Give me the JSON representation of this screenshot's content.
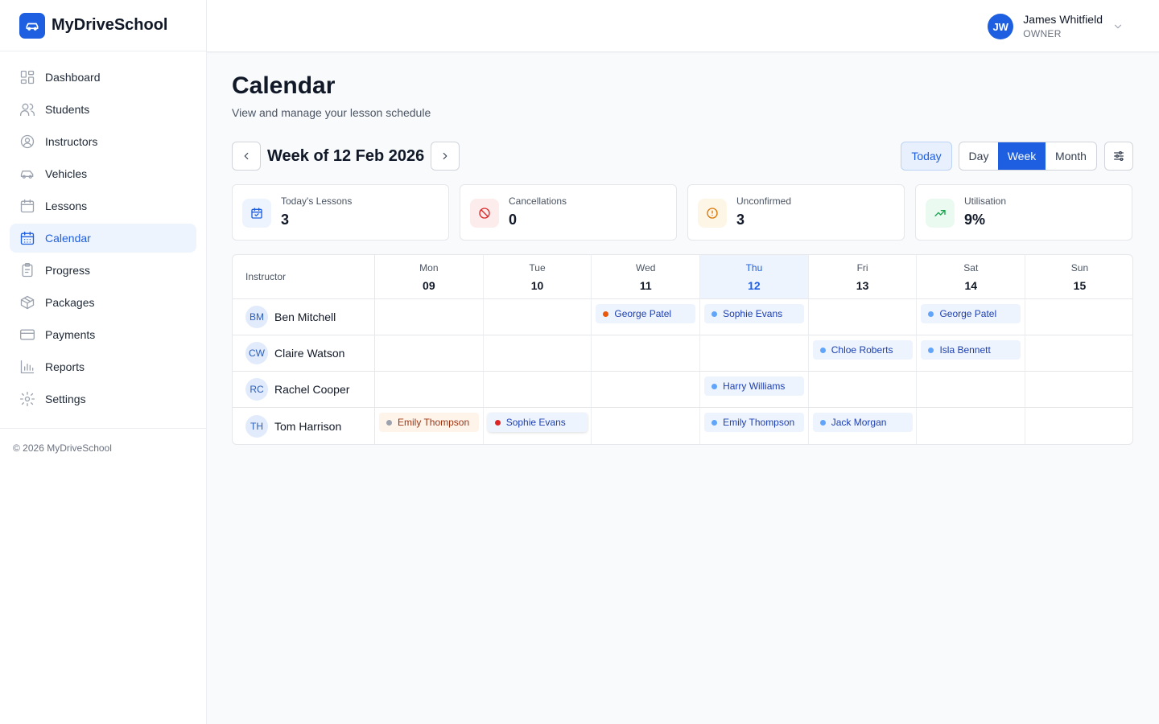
{
  "app": {
    "name": "MyDriveSchool",
    "copyright": "© 2026 MyDriveSchool"
  },
  "nav": [
    {
      "label": "Dashboard",
      "icon": "dashboard-icon",
      "active": false
    },
    {
      "label": "Students",
      "icon": "users-icon",
      "active": false
    },
    {
      "label": "Instructors",
      "icon": "user-circle-icon",
      "active": false
    },
    {
      "label": "Vehicles",
      "icon": "car-icon",
      "active": false
    },
    {
      "label": "Lessons",
      "icon": "calendar-icon",
      "active": false
    },
    {
      "label": "Calendar",
      "icon": "calendar-grid-icon",
      "active": true
    },
    {
      "label": "Progress",
      "icon": "clipboard-icon",
      "active": false
    },
    {
      "label": "Packages",
      "icon": "package-icon",
      "active": false
    },
    {
      "label": "Payments",
      "icon": "credit-card-icon",
      "active": false
    },
    {
      "label": "Reports",
      "icon": "bar-chart-icon",
      "active": false
    },
    {
      "label": "Settings",
      "icon": "gear-icon",
      "active": false
    }
  ],
  "user": {
    "initials": "JW",
    "name": "James Whitfield",
    "role": "OWNER"
  },
  "page": {
    "title": "Calendar",
    "subtitle": "View and manage your lesson schedule"
  },
  "toolbar": {
    "week_label": "Week of 12 Feb 2026",
    "today_label": "Today",
    "views": [
      "Day",
      "Week",
      "Month"
    ],
    "active_view": "Week"
  },
  "stats": [
    {
      "label": "Today's Lessons",
      "value": "3",
      "icon": "calendar-check-icon",
      "color": "#1d5fe0"
    },
    {
      "label": "Cancellations",
      "value": "0",
      "icon": "ban-icon",
      "color": "#dc2626"
    },
    {
      "label": "Unconfirmed",
      "value": "3",
      "icon": "alert-circle-icon",
      "color": "#d97706"
    },
    {
      "label": "Utilisation",
      "value": "9%",
      "icon": "trending-up-icon",
      "color": "#16a34a"
    }
  ],
  "calendar": {
    "instructor_header": "Instructor",
    "days": [
      {
        "name": "Mon",
        "num": "09"
      },
      {
        "name": "Tue",
        "num": "10"
      },
      {
        "name": "Wed",
        "num": "11"
      },
      {
        "name": "Thu",
        "num": "12",
        "today": true
      },
      {
        "name": "Fri",
        "num": "13"
      },
      {
        "name": "Sat",
        "num": "14"
      },
      {
        "name": "Sun",
        "num": "15"
      }
    ],
    "instructors": [
      {
        "initials": "BM",
        "name": "Ben Mitchell"
      },
      {
        "initials": "CW",
        "name": "Claire Watson"
      },
      {
        "initials": "RC",
        "name": "Rachel Cooper"
      },
      {
        "initials": "TH",
        "name": "Tom Harrison"
      }
    ],
    "lessons": [
      {
        "instructor": 0,
        "day": 2,
        "student": "George Patel",
        "status": "orange"
      },
      {
        "instructor": 0,
        "day": 3,
        "student": "Sophie Evans",
        "status": "blue"
      },
      {
        "instructor": 0,
        "day": 5,
        "student": "George Patel",
        "status": "blue"
      },
      {
        "instructor": 1,
        "day": 4,
        "student": "Chloe Roberts",
        "status": "blue"
      },
      {
        "instructor": 1,
        "day": 5,
        "student": "Isla Bennett",
        "status": "blue"
      },
      {
        "instructor": 2,
        "day": 3,
        "student": "Harry Williams",
        "status": "blue"
      },
      {
        "instructor": 3,
        "day": 0,
        "student": "Emily Thompson",
        "status": "grey"
      },
      {
        "instructor": 3,
        "day": 1,
        "student": "Sophie Evans",
        "status": "red"
      },
      {
        "instructor": 3,
        "day": 3,
        "student": "Emily Thompson",
        "status": "blue"
      },
      {
        "instructor": 3,
        "day": 4,
        "student": "Jack Morgan",
        "status": "blue"
      }
    ]
  }
}
